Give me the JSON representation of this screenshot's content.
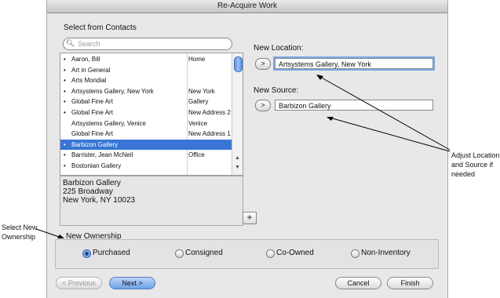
{
  "window": {
    "title": "Re-Acquire Work"
  },
  "contacts": {
    "heading": "Select from Contacts",
    "search_placeholder": "Search",
    "search_value": "",
    "rows": [
      {
        "bullet": "•",
        "name": "Aaron, Bill",
        "col2": "Home",
        "selected": false
      },
      {
        "bullet": "•",
        "name": "Art in General",
        "col2": "",
        "selected": false
      },
      {
        "bullet": "•",
        "name": "Arts Mondial",
        "col2": "",
        "selected": false
      },
      {
        "bullet": "•",
        "name": "Artsystems Gallery, New York",
        "col2": "New York",
        "selected": false
      },
      {
        "bullet": "•",
        "name": "Global Fine Art",
        "col2": "Gallery",
        "selected": false
      },
      {
        "bullet": "•",
        "name": "Global Fine Art",
        "col2": "New Address 2",
        "selected": false
      },
      {
        "bullet": "",
        "name": "Artsystems Gallery, Venice",
        "col2": "Venice",
        "selected": false
      },
      {
        "bullet": "",
        "name": "Global Fine Art",
        "col2": "New Address 1",
        "selected": false
      },
      {
        "bullet": "•",
        "name": "Barbizon Gallery",
        "col2": "",
        "selected": true
      },
      {
        "bullet": "•",
        "name": "Barrister, Jean McNeil",
        "col2": "Office",
        "selected": false
      },
      {
        "bullet": "•",
        "name": "Bostonian Gallery",
        "col2": "",
        "selected": false
      }
    ],
    "address": {
      "line1": "Barbizon Gallery",
      "line2": "225 Broadway",
      "line3": "New York, NY 10023"
    },
    "add_label": "+"
  },
  "new_location": {
    "label": "New Location:",
    "button": ">",
    "value": "Artsystems Gallery, New York"
  },
  "new_source": {
    "label": "New Source:",
    "button": ">",
    "value": "Barbizon Gallery"
  },
  "ownership": {
    "label": "New Ownership",
    "options": [
      {
        "label": "Purchased",
        "selected": true
      },
      {
        "label": "Consigned",
        "selected": false
      },
      {
        "label": "Co-Owned",
        "selected": false
      },
      {
        "label": "Non-Inventory",
        "selected": false
      }
    ]
  },
  "buttons": {
    "previous": "< Previous",
    "next": "Next >",
    "cancel": "Cancel",
    "finish": "Finish"
  },
  "annotations": {
    "right": [
      "Adjust Location",
      "and Source if",
      "needed"
    ],
    "left": [
      "Select New",
      "Ownership"
    ]
  },
  "colors": {
    "selection": "#3875d7",
    "focus_ring": "#7aa7e6",
    "default_button": "#6ea0e6"
  }
}
